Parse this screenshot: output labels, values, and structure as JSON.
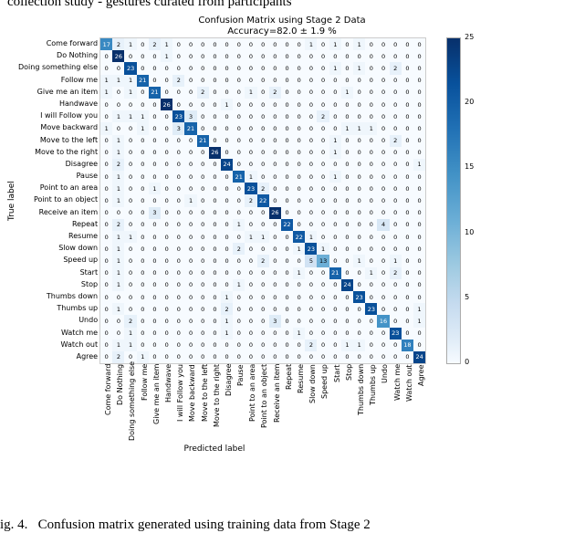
{
  "top_cropped_text": "collection study - gestures curated from participants",
  "bottom_cropped_text": "ig. 4.   Confusion matrix generated using training data from Stage 2",
  "chart_data": {
    "type": "heatmap",
    "title_line1": "Confusion Matrix using Stage 2 Data",
    "title_line2": "Accuracy=82.0 ± 1.9 %",
    "xlabel": "Predicted label",
    "ylabel": "True label",
    "categories": [
      "Come forward",
      "Do Nothing",
      "Doing something else",
      "Follow me",
      "Give me an item",
      "Handwave",
      "I will Follow you",
      "Move backward",
      "Move to the left",
      "Move to the right",
      "Disagree",
      "Pause",
      "Point to an area",
      "Point to an object",
      "Receive an item",
      "Repeat",
      "Resume",
      "Slow down",
      "Speed up",
      "Start",
      "Stop",
      "Thumbs down",
      "Thumbs up",
      "Undo",
      "Watch me",
      "Watch out",
      "Agree"
    ],
    "colorbar_ticks": [
      25,
      20,
      15,
      10,
      5,
      0
    ],
    "matrix": [
      [
        17,
        2,
        1,
        0,
        2,
        1,
        0,
        0,
        0,
        0,
        0,
        0,
        0,
        0,
        0,
        0,
        0,
        1,
        0,
        1,
        0,
        1,
        0,
        0,
        0,
        0,
        0
      ],
      [
        0,
        26,
        0,
        0,
        0,
        1,
        0,
        0,
        0,
        0,
        0,
        0,
        0,
        0,
        0,
        0,
        0,
        0,
        0,
        0,
        0,
        0,
        0,
        0,
        0,
        0,
        0
      ],
      [
        0,
        0,
        23,
        0,
        0,
        0,
        0,
        0,
        0,
        0,
        0,
        0,
        0,
        0,
        0,
        0,
        0,
        0,
        0,
        1,
        0,
        1,
        0,
        0,
        2,
        0,
        0
      ],
      [
        1,
        1,
        1,
        21,
        0,
        0,
        2,
        0,
        0,
        0,
        0,
        0,
        0,
        0,
        0,
        0,
        0,
        0,
        0,
        0,
        0,
        0,
        0,
        0,
        0,
        0,
        0
      ],
      [
        1,
        0,
        1,
        0,
        21,
        0,
        0,
        0,
        2,
        0,
        0,
        0,
        1,
        0,
        2,
        0,
        0,
        0,
        0,
        0,
        1,
        0,
        0,
        0,
        0,
        0,
        0
      ],
      [
        0,
        0,
        0,
        0,
        0,
        26,
        0,
        0,
        0,
        0,
        1,
        0,
        0,
        0,
        0,
        0,
        0,
        0,
        0,
        0,
        0,
        0,
        0,
        0,
        0,
        0,
        0
      ],
      [
        0,
        1,
        1,
        1,
        0,
        0,
        23,
        3,
        0,
        0,
        0,
        0,
        0,
        0,
        0,
        0,
        0,
        0,
        2,
        0,
        0,
        0,
        0,
        0,
        0,
        0,
        0
      ],
      [
        1,
        0,
        0,
        1,
        0,
        0,
        3,
        21,
        0,
        0,
        0,
        0,
        0,
        0,
        0,
        0,
        0,
        0,
        0,
        0,
        1,
        1,
        1,
        0,
        0,
        0,
        0
      ],
      [
        0,
        1,
        0,
        0,
        0,
        0,
        0,
        0,
        21,
        0,
        0,
        0,
        0,
        0,
        0,
        0,
        0,
        0,
        0,
        1,
        0,
        0,
        0,
        0,
        2,
        0,
        0
      ],
      [
        0,
        1,
        0,
        0,
        0,
        0,
        0,
        0,
        0,
        26,
        0,
        0,
        0,
        0,
        0,
        0,
        0,
        0,
        0,
        1,
        0,
        0,
        0,
        0,
        0,
        0,
        0
      ],
      [
        0,
        2,
        0,
        0,
        0,
        0,
        0,
        0,
        0,
        0,
        24,
        0,
        0,
        0,
        0,
        0,
        0,
        0,
        0,
        0,
        0,
        0,
        0,
        0,
        0,
        0,
        1
      ],
      [
        0,
        1,
        0,
        0,
        0,
        0,
        0,
        0,
        0,
        0,
        0,
        21,
        1,
        0,
        0,
        0,
        0,
        0,
        0,
        1,
        0,
        0,
        0,
        0,
        0,
        0,
        0
      ],
      [
        0,
        1,
        0,
        0,
        1,
        0,
        0,
        0,
        0,
        0,
        0,
        0,
        23,
        2,
        0,
        0,
        0,
        0,
        0,
        0,
        0,
        0,
        0,
        0,
        0,
        0,
        0
      ],
      [
        0,
        1,
        0,
        0,
        0,
        0,
        0,
        1,
        0,
        0,
        0,
        0,
        2,
        22,
        0,
        0,
        0,
        0,
        0,
        0,
        0,
        0,
        0,
        0,
        0,
        0,
        0
      ],
      [
        0,
        0,
        0,
        0,
        3,
        0,
        0,
        0,
        0,
        0,
        0,
        0,
        0,
        0,
        26,
        0,
        0,
        0,
        0,
        0,
        0,
        0,
        0,
        0,
        0,
        0,
        0
      ],
      [
        0,
        2,
        0,
        0,
        0,
        0,
        0,
        0,
        0,
        0,
        0,
        1,
        0,
        0,
        0,
        22,
        0,
        0,
        0,
        0,
        0,
        0,
        0,
        4,
        0,
        0,
        0
      ],
      [
        0,
        1,
        1,
        0,
        0,
        0,
        0,
        0,
        0,
        0,
        0,
        0,
        1,
        1,
        0,
        0,
        22,
        1,
        0,
        0,
        0,
        0,
        0,
        0,
        0,
        0,
        0
      ],
      [
        0,
        1,
        0,
        0,
        0,
        0,
        0,
        0,
        0,
        0,
        0,
        2,
        0,
        0,
        0,
        0,
        1,
        23,
        1,
        0,
        0,
        0,
        0,
        0,
        0,
        0,
        0
      ],
      [
        0,
        1,
        0,
        0,
        0,
        0,
        0,
        0,
        0,
        0,
        0,
        0,
        0,
        2,
        0,
        0,
        0,
        5,
        13,
        0,
        0,
        1,
        0,
        0,
        1,
        0,
        0
      ],
      [
        0,
        1,
        0,
        0,
        0,
        0,
        0,
        0,
        0,
        0,
        0,
        0,
        0,
        0,
        0,
        0,
        1,
        0,
        0,
        21,
        0,
        0,
        1,
        0,
        2,
        0,
        0
      ],
      [
        0,
        1,
        0,
        0,
        0,
        0,
        0,
        0,
        0,
        0,
        0,
        1,
        0,
        0,
        0,
        0,
        0,
        0,
        0,
        0,
        24,
        0,
        0,
        0,
        0,
        0,
        0
      ],
      [
        0,
        0,
        0,
        0,
        0,
        0,
        0,
        0,
        0,
        0,
        1,
        0,
        0,
        0,
        0,
        0,
        0,
        0,
        0,
        0,
        0,
        23,
        0,
        0,
        0,
        0,
        0
      ],
      [
        0,
        1,
        0,
        0,
        0,
        0,
        0,
        0,
        0,
        0,
        2,
        0,
        0,
        0,
        0,
        0,
        0,
        0,
        0,
        0,
        0,
        0,
        23,
        0,
        0,
        0,
        1
      ],
      [
        0,
        0,
        2,
        0,
        0,
        0,
        0,
        0,
        0,
        0,
        1,
        0,
        0,
        0,
        3,
        0,
        0,
        0,
        0,
        0,
        0,
        0,
        0,
        16,
        0,
        0,
        1
      ],
      [
        0,
        0,
        1,
        0,
        0,
        0,
        0,
        0,
        0,
        0,
        1,
        0,
        0,
        0,
        0,
        0,
        1,
        0,
        0,
        0,
        0,
        0,
        0,
        0,
        23,
        0,
        0
      ],
      [
        0,
        1,
        1,
        0,
        0,
        0,
        0,
        0,
        0,
        0,
        0,
        0,
        0,
        0,
        0,
        0,
        0,
        2,
        0,
        0,
        1,
        1,
        0,
        0,
        0,
        18,
        0
      ],
      [
        0,
        2,
        0,
        1,
        0,
        0,
        0,
        0,
        0,
        0,
        0,
        0,
        0,
        0,
        0,
        0,
        0,
        0,
        0,
        0,
        0,
        0,
        0,
        0,
        0,
        0,
        24
      ]
    ]
  }
}
